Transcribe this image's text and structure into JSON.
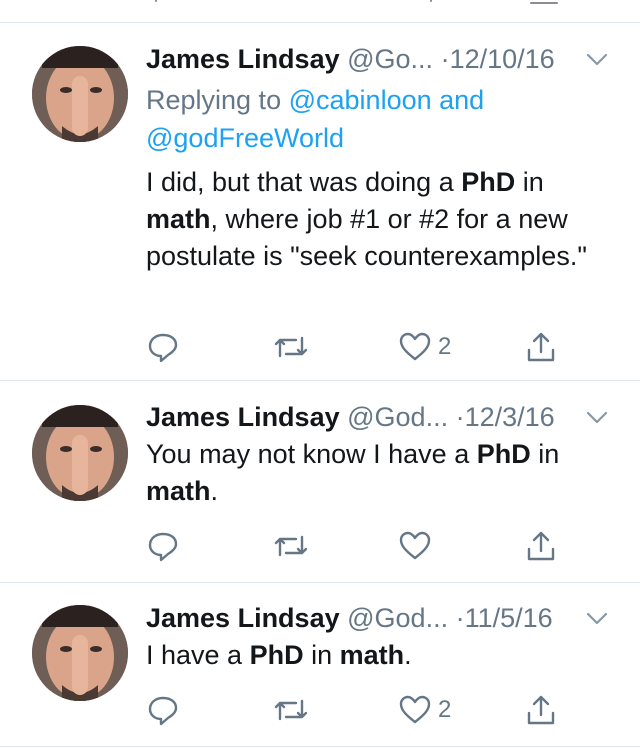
{
  "tweets": [
    {
      "name": "James Lindsay",
      "handle": "@Go...",
      "separator": "·",
      "date": "12/10/16",
      "reply_prefix": "Replying to",
      "reply_user1": "@cabinloon",
      "reply_and": "and",
      "reply_user2": "@godFreeWorld",
      "body": [
        {
          "text": "I did, but that was doing a "
        },
        {
          "text": "PhD",
          "bold": true
        },
        {
          "text": " in "
        },
        {
          "text": "math",
          "bold": true
        },
        {
          "text": ", where job #1 or #2 for a new postulate is \"seek counterexamples.\""
        }
      ],
      "likes": "2"
    },
    {
      "name": "James Lindsay",
      "handle": "@God...",
      "separator": "·",
      "date": "12/3/16",
      "body": [
        {
          "text": "You may not know I have a "
        },
        {
          "text": "PhD",
          "bold": true
        },
        {
          "text": " in "
        },
        {
          "text": "math",
          "bold": true
        },
        {
          "text": "."
        }
      ],
      "likes": ""
    },
    {
      "name": "James Lindsay",
      "handle": "@God...",
      "separator": "·",
      "date": "11/5/16",
      "body": [
        {
          "text": "I have a "
        },
        {
          "text": "PhD",
          "bold": true
        },
        {
          "text": " in "
        },
        {
          "text": "math",
          "bold": true
        },
        {
          "text": "."
        }
      ],
      "likes": "2"
    }
  ],
  "icons": {
    "reply": "reply-icon",
    "retweet": "retweet-icon",
    "like": "heart-icon",
    "share": "share-icon",
    "caret": "chevron-down-icon"
  },
  "colors": {
    "text": "#14171a",
    "muted": "#657786",
    "link": "#1da1f2",
    "divider": "#e1e8ed"
  }
}
